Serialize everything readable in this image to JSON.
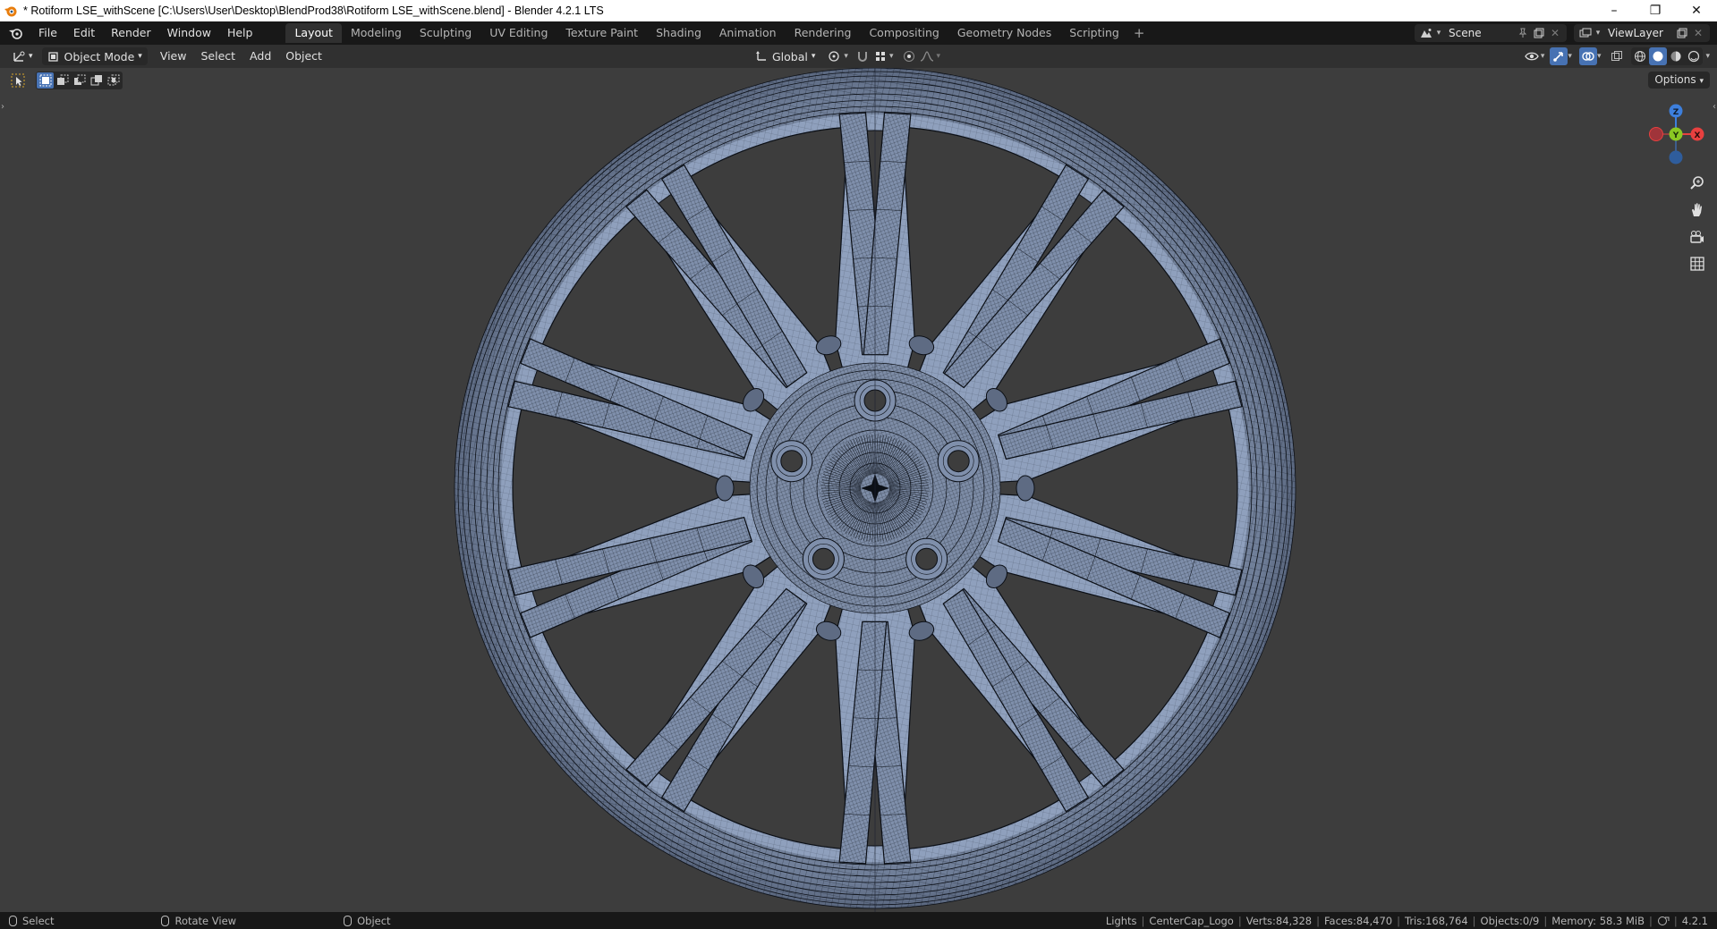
{
  "window": {
    "title": "* Rotiform LSE_withScene [C:\\Users\\User\\Desktop\\BlendProd38\\Rotiform LSE_withScene.blend] - Blender 4.2.1 LTS",
    "minimize_glyph": "–",
    "restore_glyph": "❐",
    "close_glyph": "✕"
  },
  "menubar": {
    "menus": [
      "File",
      "Edit",
      "Render",
      "Window",
      "Help"
    ],
    "workspaces": [
      "Layout",
      "Modeling",
      "Sculpting",
      "UV Editing",
      "Texture Paint",
      "Shading",
      "Animation",
      "Rendering",
      "Compositing",
      "Geometry Nodes",
      "Scripting"
    ],
    "active_workspace": "Layout",
    "add_workspace": "+",
    "scene": "Scene",
    "view_layer": "ViewLayer"
  },
  "header3d": {
    "mode": "Object Mode",
    "menus": [
      "View",
      "Select",
      "Add",
      "Object"
    ],
    "transform_orientation": "Global"
  },
  "viewport": {
    "options_label": "Options",
    "gizmo_axes": {
      "z": "Z",
      "y": "Y",
      "x": "X"
    },
    "colors": {
      "x": "#e8403f",
      "y": "#8bc823",
      "z": "#3d7fdd",
      "background": "#3d3d3d",
      "wire": "#0a0e14",
      "surface": "#7f8fab"
    }
  },
  "status": {
    "hints": [
      "Select",
      "Rotate View",
      "Object"
    ],
    "collection": "Lights",
    "active_object": "CenterCap_Logo",
    "verts": "Verts:84,328",
    "faces": "Faces:84,470",
    "tris": "Tris:168,764",
    "objects": "Objects:0/9",
    "memory": "Memory: 58.3 MiB",
    "version": "4.2.1"
  }
}
